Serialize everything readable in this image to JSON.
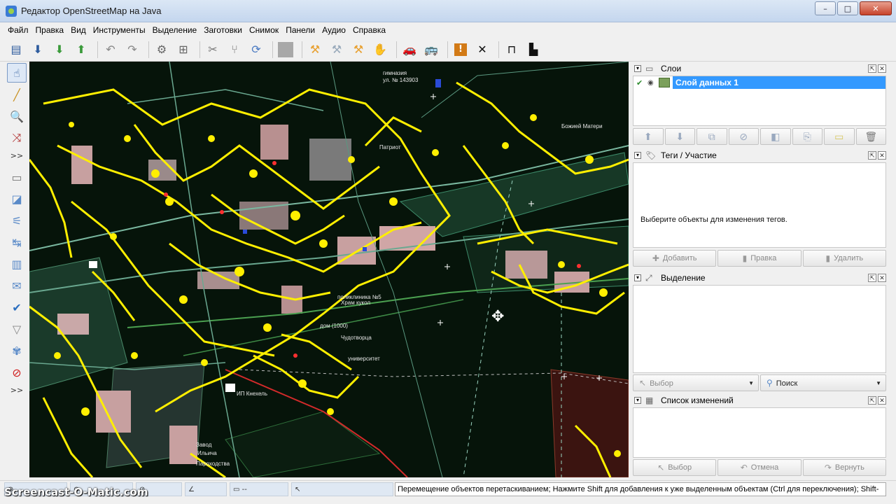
{
  "window": {
    "title": "Редактор OpenStreetMap на Java",
    "controls": {
      "minimize": "–",
      "maximize": "□",
      "close": "✕"
    }
  },
  "menu": [
    "Файл",
    "Правка",
    "Вид",
    "Инструменты",
    "Выделение",
    "Заготовки",
    "Снимок",
    "Панели",
    "Аудио",
    "Справка"
  ],
  "toolbar": {
    "icons": [
      "open-icon",
      "download-icon",
      "upload-icon",
      "save-icon",
      "undo-icon",
      "redo-icon",
      "preferences-icon",
      "zoom-to-icon",
      "split-way-icon",
      "combine-way-icon",
      "reload-icon",
      "disabled-icon",
      "align-icon",
      "unglue-icon",
      "split-icon",
      "move-icon",
      "car-icon",
      "bus-icon",
      "warning-icon",
      "delete-icon",
      "bridge-icon",
      "elevation-icon"
    ]
  },
  "lefttools": {
    "more_label": ">>"
  },
  "map": {
    "labels": [
      "гимназия",
      "ул. № 143903",
      "Патриот",
      "Храм кукол",
      "поликлиника №5",
      "дом (1000)",
      "Чудотворца",
      "университет",
      "ИП Кнехель",
      "Завод",
      "Ильича",
      "Пароходства",
      "Божией Матери"
    ]
  },
  "panels": {
    "layers": {
      "title": "Слои",
      "layer_name": "Слой данных 1"
    },
    "tags": {
      "title": "Теги / Участие",
      "empty_message": "Выберите объекты для изменения тегов.",
      "add_label": "Добавить",
      "edit_label": "Правка",
      "delete_label": "Удалить"
    },
    "selection": {
      "title": "Выделение",
      "select_label": "Выбор",
      "search_label": "Поиск"
    },
    "changes": {
      "title": "Список изменений",
      "select_label": "Выбор",
      "cancel_label": "Отмена",
      "revert_label": "Вернуть"
    }
  },
  "statusbar": {
    "distance_value": "--",
    "help_text": "Перемещение объектов перетаскиванием; Нажмите Shift для добавления к уже выделенным объектам (Ctrl для переключения); Shift-"
  },
  "watermark": "Screencast-O-Matic.com"
}
